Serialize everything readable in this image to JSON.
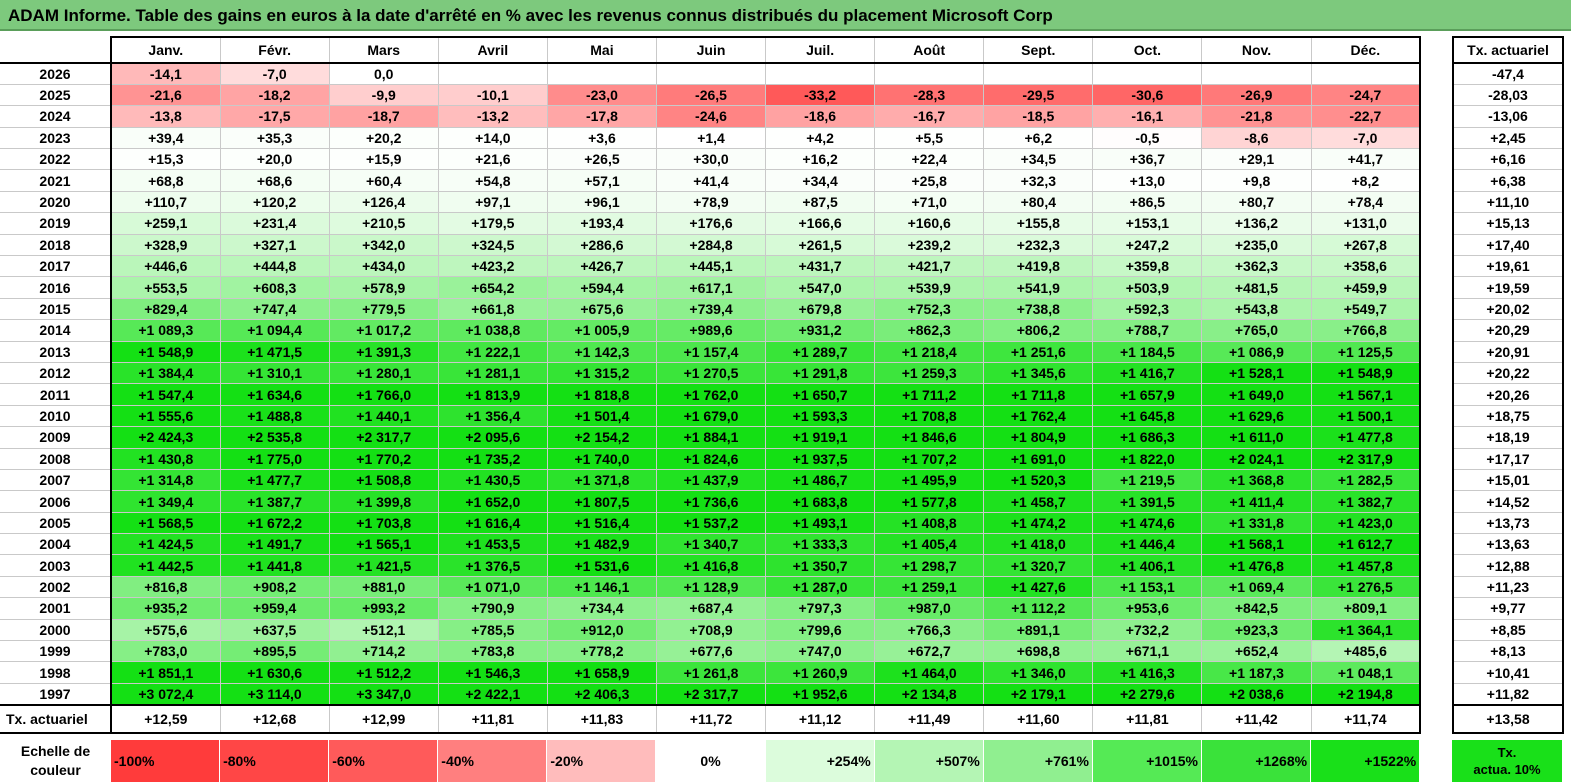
{
  "title": "ADAM Informe. Table des gains en euros à la date d'arrêté en % avec les revenus connus distribués du placement Microsoft Corp",
  "months": [
    "Janv.",
    "Févr.",
    "Mars",
    "Avril",
    "Mai",
    "Juin",
    "Juil.",
    "Août",
    "Sept.",
    "Oct.",
    "Nov.",
    "Déc."
  ],
  "side_header": "Tx. actuariel",
  "rows": [
    {
      "year": "2026",
      "values": [
        "-14,1",
        "-7,0",
        "0,0",
        "",
        "",
        "",
        "",
        "",
        "",
        "",
        "",
        ""
      ],
      "rate": "-47,4"
    },
    {
      "year": "2025",
      "values": [
        "-21,6",
        "-18,2",
        "-9,9",
        "-10,1",
        "-23,0",
        "-26,5",
        "-33,2",
        "-28,3",
        "-29,5",
        "-30,6",
        "-26,9",
        "-24,7"
      ],
      "rate": "-28,03"
    },
    {
      "year": "2024",
      "values": [
        "-13,8",
        "-17,5",
        "-18,7",
        "-13,2",
        "-17,8",
        "-24,6",
        "-18,6",
        "-16,7",
        "-18,5",
        "-16,1",
        "-21,8",
        "-22,7"
      ],
      "rate": "-13,06"
    },
    {
      "year": "2023",
      "values": [
        "+39,4",
        "+35,3",
        "+20,2",
        "+14,0",
        "+3,6",
        "+1,4",
        "+4,2",
        "+5,5",
        "+6,2",
        "-0,5",
        "-8,6",
        "-7,0"
      ],
      "rate": "+2,45"
    },
    {
      "year": "2022",
      "values": [
        "+15,3",
        "+20,0",
        "+15,9",
        "+21,6",
        "+26,5",
        "+30,0",
        "+16,2",
        "+22,4",
        "+34,5",
        "+36,7",
        "+29,1",
        "+41,7"
      ],
      "rate": "+6,16"
    },
    {
      "year": "2021",
      "values": [
        "+68,8",
        "+68,6",
        "+60,4",
        "+54,8",
        "+57,1",
        "+41,4",
        "+34,4",
        "+25,8",
        "+32,3",
        "+13,0",
        "+9,8",
        "+8,2"
      ],
      "rate": "+6,38"
    },
    {
      "year": "2020",
      "values": [
        "+110,7",
        "+120,2",
        "+126,4",
        "+97,1",
        "+96,1",
        "+78,9",
        "+87,5",
        "+71,0",
        "+80,4",
        "+86,5",
        "+80,7",
        "+78,4"
      ],
      "rate": "+11,10"
    },
    {
      "year": "2019",
      "values": [
        "+259,1",
        "+231,4",
        "+210,5",
        "+179,5",
        "+193,4",
        "+176,6",
        "+166,6",
        "+160,6",
        "+155,8",
        "+153,1",
        "+136,2",
        "+131,0"
      ],
      "rate": "+15,13"
    },
    {
      "year": "2018",
      "values": [
        "+328,9",
        "+327,1",
        "+342,0",
        "+324,5",
        "+286,6",
        "+284,8",
        "+261,5",
        "+239,2",
        "+232,3",
        "+247,2",
        "+235,0",
        "+267,8"
      ],
      "rate": "+17,40"
    },
    {
      "year": "2017",
      "values": [
        "+446,6",
        "+444,8",
        "+434,0",
        "+423,2",
        "+426,7",
        "+445,1",
        "+431,7",
        "+421,7",
        "+419,8",
        "+359,8",
        "+362,3",
        "+358,6"
      ],
      "rate": "+19,61"
    },
    {
      "year": "2016",
      "values": [
        "+553,5",
        "+608,3",
        "+578,9",
        "+654,2",
        "+594,4",
        "+617,1",
        "+547,0",
        "+539,9",
        "+541,9",
        "+503,9",
        "+481,5",
        "+459,9"
      ],
      "rate": "+19,59"
    },
    {
      "year": "2015",
      "values": [
        "+829,4",
        "+747,4",
        "+779,5",
        "+661,8",
        "+675,6",
        "+739,4",
        "+679,8",
        "+752,3",
        "+738,8",
        "+592,3",
        "+543,8",
        "+549,7"
      ],
      "rate": "+20,02"
    },
    {
      "year": "2014",
      "values": [
        "+1 089,3",
        "+1 094,4",
        "+1 017,2",
        "+1 038,8",
        "+1 005,9",
        "+989,6",
        "+931,2",
        "+862,3",
        "+806,2",
        "+788,7",
        "+765,0",
        "+766,8"
      ],
      "rate": "+20,29"
    },
    {
      "year": "2013",
      "values": [
        "+1 548,9",
        "+1 471,5",
        "+1 391,3",
        "+1 222,1",
        "+1 142,3",
        "+1 157,4",
        "+1 289,7",
        "+1 218,4",
        "+1 251,6",
        "+1 184,5",
        "+1 086,9",
        "+1 125,5"
      ],
      "rate": "+20,91"
    },
    {
      "year": "2012",
      "values": [
        "+1 384,4",
        "+1 310,1",
        "+1 280,1",
        "+1 281,1",
        "+1 315,2",
        "+1 270,5",
        "+1 291,8",
        "+1 259,3",
        "+1 345,6",
        "+1 416,7",
        "+1 528,1",
        "+1 548,9"
      ],
      "rate": "+20,22"
    },
    {
      "year": "2011",
      "values": [
        "+1 547,4",
        "+1 634,6",
        "+1 766,0",
        "+1 813,9",
        "+1 818,8",
        "+1 762,0",
        "+1 650,7",
        "+1 711,2",
        "+1 711,8",
        "+1 657,9",
        "+1 649,0",
        "+1 567,1"
      ],
      "rate": "+20,26"
    },
    {
      "year": "2010",
      "values": [
        "+1 555,6",
        "+1 488,8",
        "+1 440,1",
        "+1 356,4",
        "+1 501,4",
        "+1 679,0",
        "+1 593,3",
        "+1 708,8",
        "+1 762,4",
        "+1 645,8",
        "+1 629,6",
        "+1 500,1"
      ],
      "rate": "+18,75"
    },
    {
      "year": "2009",
      "values": [
        "+2 424,3",
        "+2 535,8",
        "+2 317,7",
        "+2 095,6",
        "+2 154,2",
        "+1 884,1",
        "+1 919,1",
        "+1 846,6",
        "+1 804,9",
        "+1 686,3",
        "+1 611,0",
        "+1 477,8"
      ],
      "rate": "+18,19"
    },
    {
      "year": "2008",
      "values": [
        "+1 430,8",
        "+1 775,0",
        "+1 770,2",
        "+1 735,2",
        "+1 740,0",
        "+1 824,6",
        "+1 937,5",
        "+1 707,2",
        "+1 691,0",
        "+1 822,0",
        "+2 024,1",
        "+2 317,9"
      ],
      "rate": "+17,17"
    },
    {
      "year": "2007",
      "values": [
        "+1 314,8",
        "+1 477,7",
        "+1 508,8",
        "+1 430,5",
        "+1 371,8",
        "+1 437,9",
        "+1 486,7",
        "+1 495,9",
        "+1 520,3",
        "+1 219,5",
        "+1 368,8",
        "+1 282,5"
      ],
      "rate": "+15,01"
    },
    {
      "year": "2006",
      "values": [
        "+1 349,4",
        "+1 387,7",
        "+1 399,8",
        "+1 652,0",
        "+1 807,5",
        "+1 736,6",
        "+1 683,8",
        "+1 577,8",
        "+1 458,7",
        "+1 391,5",
        "+1 411,4",
        "+1 382,7"
      ],
      "rate": "+14,52"
    },
    {
      "year": "2005",
      "values": [
        "+1 568,5",
        "+1 672,2",
        "+1 703,8",
        "+1 616,4",
        "+1 516,4",
        "+1 537,2",
        "+1 493,1",
        "+1 408,8",
        "+1 474,2",
        "+1 474,6",
        "+1 331,8",
        "+1 423,0"
      ],
      "rate": "+13,73"
    },
    {
      "year": "2004",
      "values": [
        "+1 424,5",
        "+1 491,7",
        "+1 565,1",
        "+1 453,5",
        "+1 482,9",
        "+1 340,7",
        "+1 333,3",
        "+1 405,4",
        "+1 418,0",
        "+1 446,4",
        "+1 568,1",
        "+1 612,7"
      ],
      "rate": "+13,63"
    },
    {
      "year": "2003",
      "values": [
        "+1 442,5",
        "+1 441,8",
        "+1 421,5",
        "+1 376,5",
        "+1 531,6",
        "+1 416,8",
        "+1 350,7",
        "+1 298,7",
        "+1 320,7",
        "+1 406,1",
        "+1 476,8",
        "+1 457,8"
      ],
      "rate": "+12,88"
    },
    {
      "year": "2002",
      "values": [
        "+816,8",
        "+908,2",
        "+881,0",
        "+1 071,0",
        "+1 146,1",
        "+1 128,9",
        "+1 287,0",
        "+1 259,1",
        "+1 427,6",
        "+1 153,1",
        "+1 069,4",
        "+1 276,5"
      ],
      "rate": "+11,23"
    },
    {
      "year": "2001",
      "values": [
        "+935,2",
        "+959,4",
        "+993,2",
        "+790,9",
        "+734,4",
        "+687,4",
        "+797,3",
        "+987,0",
        "+1 112,2",
        "+953,6",
        "+842,5",
        "+809,1"
      ],
      "rate": "+9,77"
    },
    {
      "year": "2000",
      "values": [
        "+575,6",
        "+637,5",
        "+512,1",
        "+785,5",
        "+912,0",
        "+708,9",
        "+799,6",
        "+766,3",
        "+891,1",
        "+732,2",
        "+923,3",
        "+1 364,1"
      ],
      "rate": "+8,85"
    },
    {
      "year": "1999",
      "values": [
        "+783,0",
        "+895,5",
        "+714,2",
        "+783,8",
        "+778,2",
        "+677,6",
        "+747,0",
        "+672,7",
        "+698,8",
        "+671,1",
        "+652,4",
        "+485,6"
      ],
      "rate": "+8,13"
    },
    {
      "year": "1998",
      "values": [
        "+1 851,1",
        "+1 630,6",
        "+1 512,2",
        "+1 546,3",
        "+1 658,9",
        "+1 261,8",
        "+1 260,9",
        "+1 464,0",
        "+1 346,0",
        "+1 416,3",
        "+1 187,3",
        "+1 048,1"
      ],
      "rate": "+10,41"
    },
    {
      "year": "1997",
      "values": [
        "+3 072,4",
        "+3 114,0",
        "+3 347,0",
        "+2 422,1",
        "+2 406,3",
        "+2 317,7",
        "+1 952,6",
        "+2 134,8",
        "+2 179,1",
        "+2 279,6",
        "+2 038,6",
        "+2 194,8"
      ],
      "rate": "+11,82"
    }
  ],
  "footer": {
    "label": "Tx. actuariel",
    "values": [
      "+12,59",
      "+12,68",
      "+12,99",
      "+11,81",
      "+11,83",
      "+11,72",
      "+11,12",
      "+11,49",
      "+11,60",
      "+11,81",
      "+11,42",
      "+11,74"
    ],
    "overall": "+13,58"
  },
  "legend": {
    "label_line1": "Echelle de",
    "label_line2": "couleur",
    "cells": [
      {
        "text": "-100%",
        "color": "#ff3b3b",
        "align": "left"
      },
      {
        "text": "-80%",
        "color": "#ff4646",
        "align": "left"
      },
      {
        "text": "-60%",
        "color": "#ff5a5a",
        "align": "left"
      },
      {
        "text": "-40%",
        "color": "#ff7f7f",
        "align": "left"
      },
      {
        "text": "-20%",
        "color": "#ffbcbc",
        "align": "left"
      },
      {
        "text": "0%",
        "color": "#ffffff",
        "align": "mid"
      },
      {
        "text": "+254%",
        "color": "#dcfcdc",
        "align": "right"
      },
      {
        "text": "+507%",
        "color": "#b4f5b4",
        "align": "right"
      },
      {
        "text": "+761%",
        "color": "#90ef90",
        "align": "right"
      },
      {
        "text": "+1015%",
        "color": "#55ea55",
        "align": "right"
      },
      {
        "text": "+1268%",
        "color": "#3ae23a",
        "align": "right"
      },
      {
        "text": "+1522%",
        "color": "#19e019",
        "align": "right"
      }
    ],
    "side_line1": "Tx.",
    "side_line2": "actua. 10%",
    "side_color": "#19e019"
  },
  "colors": {
    "title_bg": "#7dc97d",
    "negative_max": "#ff5050",
    "positive_max": "#14e014"
  }
}
